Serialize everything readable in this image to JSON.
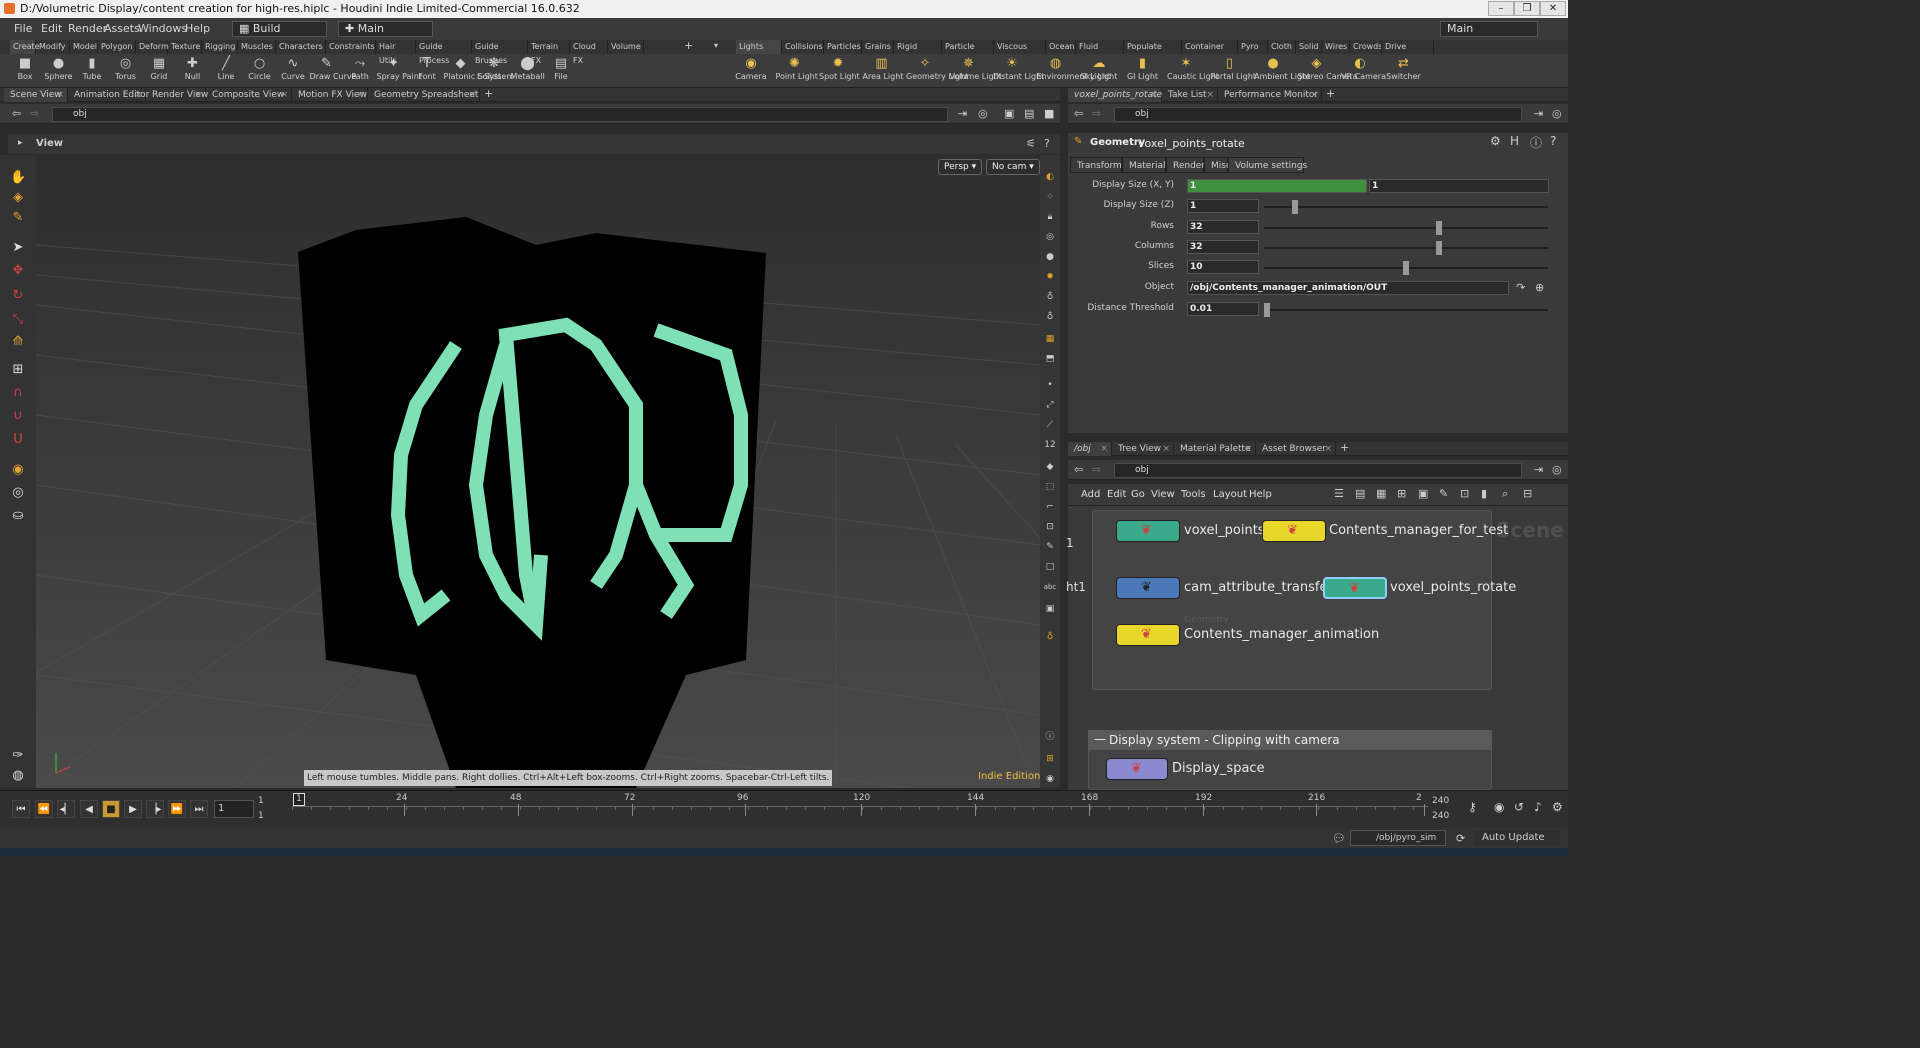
{
  "window": {
    "title": "D:/Volumetric Display/content creation for high-res.hiplc - Houdini Indie Limited-Commercial 16.0.632",
    "min": "–",
    "max": "❐",
    "close": "✕"
  },
  "menubar": {
    "items": [
      "File",
      "Edit",
      "Render",
      "Assets",
      "Windows",
      "Help"
    ],
    "desktop": "Build",
    "context": "Main",
    "right_desktop": "Main"
  },
  "shelf_tabs_left": [
    "Create",
    "Modify",
    "Model",
    "Polygon",
    "Deform",
    "Texture",
    "Rigging",
    "Muscles",
    "Characters",
    "Constraints",
    "Hair Utils",
    "Guide Process",
    "Guide Brushes",
    "Terrain FX",
    "Cloud FX",
    "Volume"
  ],
  "shelf_tabs_right": [
    "Lights and C...",
    "Collisions",
    "Particles",
    "Grains",
    "Rigid Bodies",
    "Particle Fluids",
    "Viscous Fluids",
    "Oceans",
    "Fluid Contai...",
    "Populate Con...",
    "Container Tools",
    "Pyro FX",
    "Cloth",
    "Solid",
    "Wires",
    "Crowds",
    "Drive Simula..."
  ],
  "tools_left": [
    {
      "label": "Box",
      "icon": "■"
    },
    {
      "label": "Sphere",
      "icon": "●"
    },
    {
      "label": "Tube",
      "icon": "▮"
    },
    {
      "label": "Torus",
      "icon": "◎"
    },
    {
      "label": "Grid",
      "icon": "▦"
    },
    {
      "label": "Null",
      "icon": "✚"
    },
    {
      "label": "Line",
      "icon": "╱"
    },
    {
      "label": "Circle",
      "icon": "○"
    },
    {
      "label": "Curve",
      "icon": "∿"
    },
    {
      "label": "Draw Curve",
      "icon": "✎"
    },
    {
      "label": "Path",
      "icon": "⤳"
    },
    {
      "label": "Spray Paint",
      "icon": "✦"
    },
    {
      "label": "Font",
      "icon": "T"
    },
    {
      "label": "Platonic Solids",
      "icon": "◆"
    },
    {
      "label": "L-System",
      "icon": "❋"
    },
    {
      "label": "Metaball",
      "icon": "⬤"
    },
    {
      "label": "File",
      "icon": "▤"
    }
  ],
  "tools_right": [
    {
      "label": "Camera",
      "icon": "◉"
    },
    {
      "label": "Point Light",
      "icon": "✺"
    },
    {
      "label": "Spot Light",
      "icon": "✹"
    },
    {
      "label": "Area Light",
      "icon": "▥"
    },
    {
      "label": "Geometry Light",
      "icon": "✧"
    },
    {
      "label": "Volume Light",
      "icon": "✵"
    },
    {
      "label": "Distant Light",
      "icon": "☀"
    },
    {
      "label": "Environment Light",
      "icon": "◍"
    },
    {
      "label": "Sky Light",
      "icon": "☁"
    },
    {
      "label": "GI Light",
      "icon": "▮"
    },
    {
      "label": "Caustic Light",
      "icon": "✶"
    },
    {
      "label": "Portal Light",
      "icon": "▯"
    },
    {
      "label": "Ambient Light",
      "icon": "●"
    },
    {
      "label": "Stereo Camera",
      "icon": "◈"
    },
    {
      "label": "VR Camera",
      "icon": "◐"
    },
    {
      "label": "Switcher",
      "icon": "⇄"
    }
  ],
  "left_pane_tabs": [
    "Scene View",
    "Animation Editor",
    "Render View",
    "Composite View",
    "Motion FX View",
    "Geometry Spreadsheet"
  ],
  "left_path": "obj",
  "view_label": "View",
  "viewport": {
    "persp": "Persp",
    "cam": "No cam",
    "hint": "Left mouse tumbles. Middle pans. Right dollies. Ctrl+Alt+Left box-zooms. Ctrl+Right zooms. Spacebar-Ctrl-Left tilts.",
    "edition": "Indie Edition"
  },
  "right_pane_tabs": [
    "voxel_points_rotate",
    "Take List",
    "Performance Monitor"
  ],
  "right_path": "obj",
  "params": {
    "type": "Geometry",
    "name": "voxel_points_rotate",
    "tabs": [
      "Transform",
      "Material",
      "Render",
      "Misc",
      "Volume settings"
    ],
    "rows": [
      {
        "label": "Display Size (X, Y)",
        "v1": "1",
        "v2": "1"
      },
      {
        "label": "Display Size (Z)",
        "v1": "1"
      },
      {
        "label": "Rows",
        "v1": "32"
      },
      {
        "label": "Columns",
        "v1": "32"
      },
      {
        "label": "Slices",
        "v1": "10"
      },
      {
        "label": "Object",
        "v1": "/obj/Contents_manager_animation/OUT"
      },
      {
        "label": "Distance Threshold",
        "v1": "0.01"
      }
    ]
  },
  "net_tabs": [
    "/obj",
    "Tree View",
    "Material Palette",
    "Asset Browser"
  ],
  "net_path": "obj",
  "net_menu": [
    "Add",
    "Edit",
    "Go",
    "View",
    "Tools",
    "Layout",
    "Help"
  ],
  "net": {
    "scene_label": "Scene",
    "side1": "1",
    "side2": "ht1",
    "geo_label": "Geometry",
    "nodes": [
      "voxel_points",
      "Contents_manager_for_test",
      "cam_attribute_transfer",
      "voxel_points_rotate",
      "Contents_manager_animation"
    ],
    "box_title": "Display system - Clipping with camera",
    "box_collapse": "—",
    "box_node": "Display_space"
  },
  "timeline": {
    "frame": "1",
    "start": "1",
    "start2": "1",
    "end": "240",
    "end2": "240",
    "ticks": [
      "1",
      "24",
      "48",
      "72",
      "96",
      "120",
      "144",
      "168",
      "192",
      "216",
      "2"
    ]
  },
  "bottom": {
    "path": "/obj/pyro_sim",
    "update": "Auto Update"
  },
  "colors": {
    "teal": "#3aaa8a",
    "yellow": "#e8d62a",
    "blue": "#4a78b8",
    "purple": "#8a8ad0",
    "green_field": "#3f8f3f"
  }
}
